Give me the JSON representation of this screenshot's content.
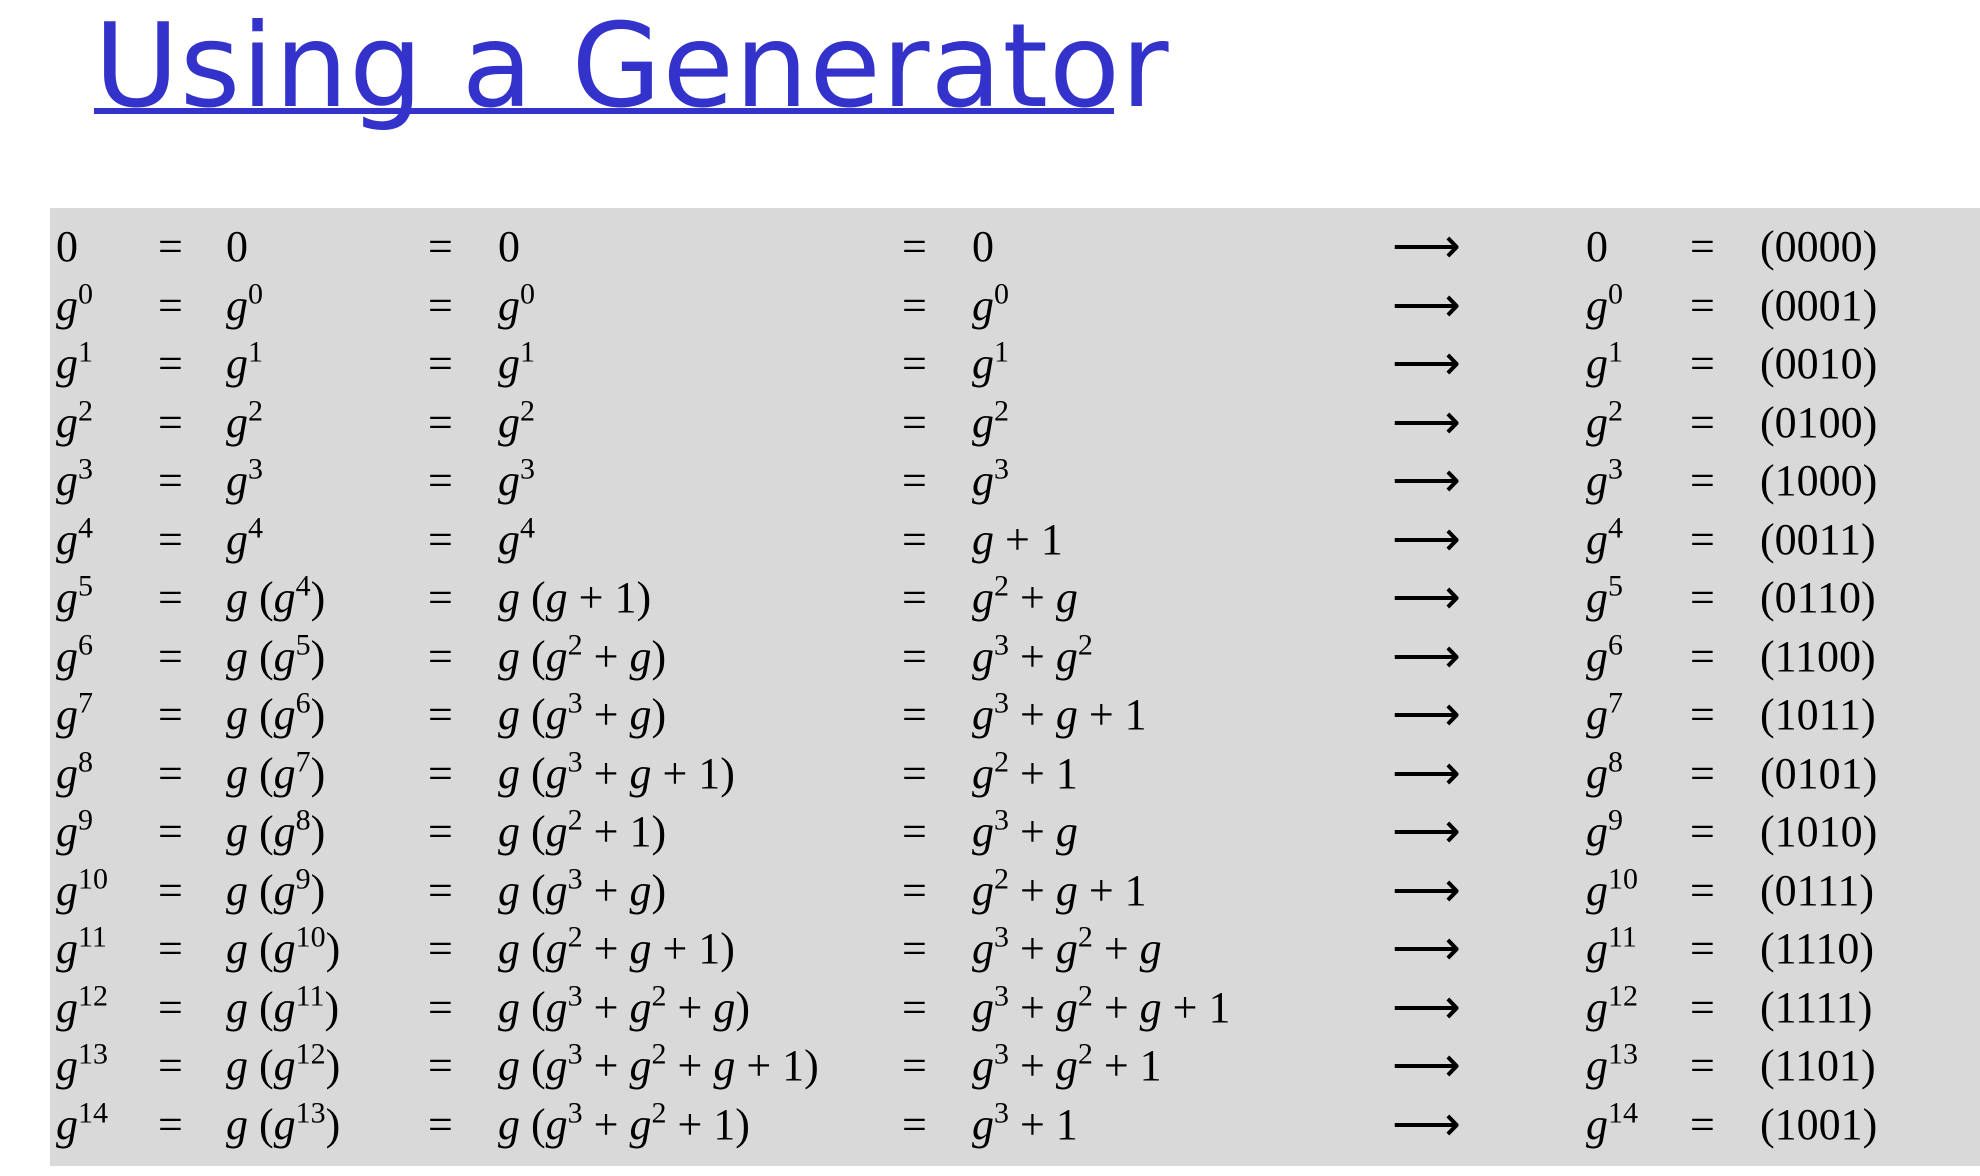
{
  "title": "Using a Generator",
  "rows": [
    {
      "lhs": "0",
      "c2": "0",
      "c3": "0",
      "c4": "0",
      "res": "0",
      "bin": "(0000)"
    },
    {
      "lhs": "g<sup>0</sup>",
      "c2": "g<sup>0</sup>",
      "c3": "g<sup>0</sup>",
      "c4": "g<sup>0</sup>",
      "res": "g<sup>0</sup>",
      "bin": "(0001)"
    },
    {
      "lhs": "g<sup>1</sup>",
      "c2": "g<sup>1</sup>",
      "c3": "g<sup>1</sup>",
      "c4": "g<sup>1</sup>",
      "res": "g<sup>1</sup>",
      "bin": "(0010)"
    },
    {
      "lhs": "g<sup>2</sup>",
      "c2": "g<sup>2</sup>",
      "c3": "g<sup>2</sup>",
      "c4": "g<sup>2</sup>",
      "res": "g<sup>2</sup>",
      "bin": "(0100)"
    },
    {
      "lhs": "g<sup>3</sup>",
      "c2": "g<sup>3</sup>",
      "c3": "g<sup>3</sup>",
      "c4": "g<sup>3</sup>",
      "res": "g<sup>3</sup>",
      "bin": "(1000)"
    },
    {
      "lhs": "g<sup>4</sup>",
      "c2": "g<sup>4</sup>",
      "c3": "g<sup>4</sup>",
      "c4": "g + 1",
      "res": "g<sup>4</sup>",
      "bin": "(0011)"
    },
    {
      "lhs": "g<sup>5</sup>",
      "c2": "g (g<sup>4</sup>)",
      "c3": "g (g + 1)",
      "c4": "g<sup>2</sup> + g",
      "res": "g<sup>5</sup>",
      "bin": "(0110)"
    },
    {
      "lhs": "g<sup>6</sup>",
      "c2": "g (g<sup>5</sup>)",
      "c3": "g (g<sup>2</sup> + g)",
      "c4": "g<sup>3</sup> + g<sup>2</sup>",
      "res": "g<sup>6</sup>",
      "bin": "(1100)"
    },
    {
      "lhs": "g<sup>7</sup>",
      "c2": "g (g<sup>6</sup>)",
      "c3": "g (g<sup>3</sup> + g)",
      "c4": "g<sup>3</sup> + g + 1",
      "res": "g<sup>7</sup>",
      "bin": "(1011)"
    },
    {
      "lhs": "g<sup>8</sup>",
      "c2": "g (g<sup>7</sup>)",
      "c3": "g (g<sup>3</sup> + g + 1)",
      "c4": "g<sup>2</sup> + 1",
      "res": "g<sup>8</sup>",
      "bin": "(0101)"
    },
    {
      "lhs": "g<sup>9</sup>",
      "c2": "g (g<sup>8</sup>)",
      "c3": "g (g<sup>2</sup> + 1)",
      "c4": "g<sup>3</sup> + g",
      "res": "g<sup>9</sup>",
      "bin": "(1010)"
    },
    {
      "lhs": "g<sup>10</sup>",
      "c2": "g (g<sup>9</sup>)",
      "c3": "g (g<sup>3</sup> + g)",
      "c4": "g<sup>2</sup> + g + 1",
      "res": "g<sup>10</sup>",
      "bin": "(0111)"
    },
    {
      "lhs": "g<sup>11</sup>",
      "c2": "g (g<sup>10</sup>)",
      "c3": "g (g<sup>2</sup> + g + 1)",
      "c4": "g<sup>3</sup> + g<sup>2</sup> + g",
      "res": "g<sup>11</sup>",
      "bin": "(1110)"
    },
    {
      "lhs": "g<sup>12</sup>",
      "c2": "g (g<sup>11</sup>)",
      "c3": "g (g<sup>3</sup> + g<sup>2</sup> + g)",
      "c4": "g<sup>3</sup> + g<sup>2</sup> + g + 1",
      "res": "g<sup>12</sup>",
      "bin": "(1111)"
    },
    {
      "lhs": "g<sup>13</sup>",
      "c2": "g (g<sup>12</sup>)",
      "c3": "g (g<sup>3</sup> + g<sup>2</sup> + g + 1)",
      "c4": "g<sup>3</sup> + g<sup>2</sup> + 1",
      "res": "g<sup>13</sup>",
      "bin": "(1101)"
    },
    {
      "lhs": "g<sup>14</sup>",
      "c2": "g (g<sup>13</sup>)",
      "c3": "g (g<sup>3</sup> + g<sup>2</sup> + 1)",
      "c4": "g<sup>3</sup> + 1",
      "res": "g<sup>14</sup>",
      "bin": "(1001)"
    }
  ],
  "symbols": {
    "equals": "=",
    "arrow": "⟶"
  }
}
